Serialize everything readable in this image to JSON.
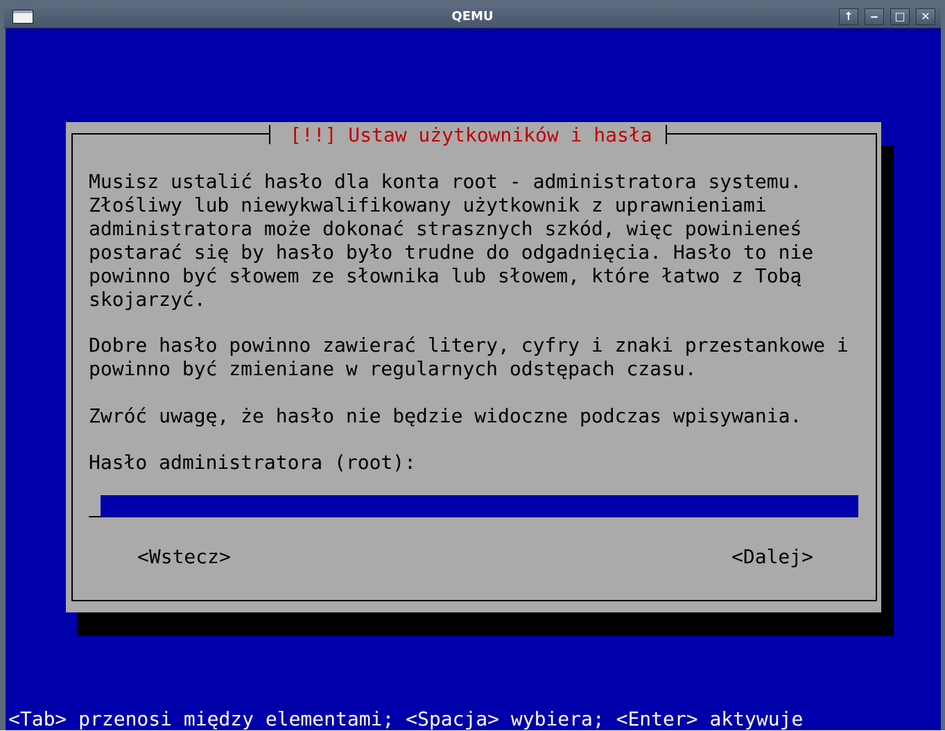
{
  "window": {
    "title": "QEMU",
    "buttons": {
      "up": "↑",
      "minimize": "‒",
      "maximize": "□",
      "close": "✕"
    }
  },
  "dialog": {
    "title": "[!!] Ustaw użytkowników i hasła",
    "paragraph1": [
      "Musisz ustalić hasło dla konta root - administratora systemu.",
      "Złośliwy lub niewykwalifikowany użytkownik z uprawnieniami",
      "administratora może dokonać strasznych szkód, więc powinieneś",
      "postarać się by hasło było trudne do odgadnięcia. Hasło to nie",
      "powinno być słowem ze słownika lub słowem, które łatwo z Tobą",
      "skojarzyć."
    ],
    "paragraph2": [
      "Dobre hasło powinno zawierać litery, cyfry i znaki przestankowe i",
      "powinno być zmieniane w regularnych odstępach czasu."
    ],
    "paragraph3": "Zwróć uwagę, że hasło nie będzie widoczne podczas wpisywania.",
    "prompt": "Hasło administratora (root):",
    "password_value": "",
    "back_button": "<Wstecz>",
    "next_button": "<Dalej>"
  },
  "help_line": "<Tab> przenosi między elementami; <Spacja> wybiera; <Enter> aktywuje",
  "colors": {
    "screen_bg": "#0000aa",
    "dialog_bg": "#aaaaaa",
    "title_fg": "#c00000",
    "help_fg": "#ffffff"
  }
}
